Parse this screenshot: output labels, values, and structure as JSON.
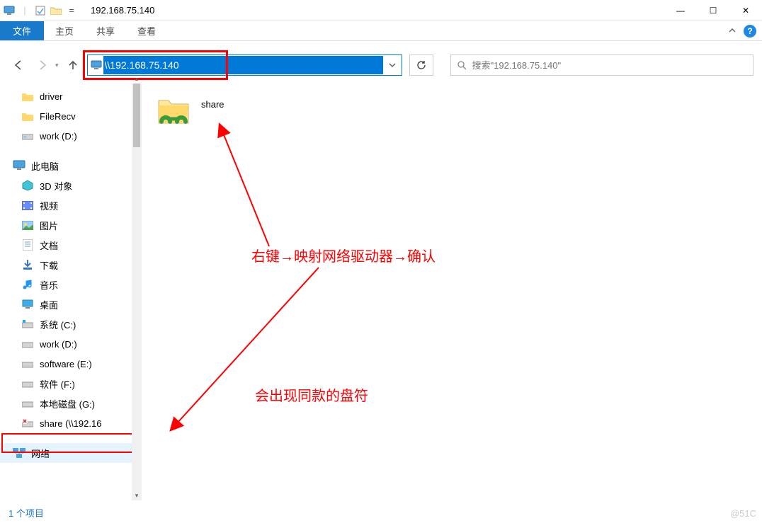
{
  "titlebar": {
    "title": "192.168.75.140",
    "minimize": "—",
    "maximize": "☐",
    "close": "✕"
  },
  "ribbon": {
    "file": "文件",
    "tabs": [
      "主页",
      "共享",
      "查看"
    ],
    "help": "?"
  },
  "nav": {
    "address": "\\\\192.168.75.140",
    "refresh": "↻",
    "search_placeholder": "搜索\"192.168.75.140\""
  },
  "tree": {
    "quick": [
      {
        "label": "driver",
        "icon": "folder"
      },
      {
        "label": "FileRecv",
        "icon": "folder"
      },
      {
        "label": "work (D:)",
        "icon": "drive"
      }
    ],
    "thispc_label": "此电脑",
    "thispc": [
      {
        "label": "3D 对象",
        "icon": "3d"
      },
      {
        "label": "视频",
        "icon": "video"
      },
      {
        "label": "图片",
        "icon": "pictures"
      },
      {
        "label": "文档",
        "icon": "documents"
      },
      {
        "label": "下载",
        "icon": "downloads"
      },
      {
        "label": "音乐",
        "icon": "music"
      },
      {
        "label": "桌面",
        "icon": "desktop"
      },
      {
        "label": "系统 (C:)",
        "icon": "osdrive"
      },
      {
        "label": "work (D:)",
        "icon": "drive"
      },
      {
        "label": "software (E:)",
        "icon": "drive"
      },
      {
        "label": "软件 (F:)",
        "icon": "drive"
      },
      {
        "label": "本地磁盘 (G:)",
        "icon": "drive"
      },
      {
        "label": "share (\\\\192.16",
        "icon": "netdrive-x"
      }
    ],
    "network_label": "网络"
  },
  "content": {
    "item_label": "share"
  },
  "annotations": {
    "line1": "右键→映射网络驱动器→确认",
    "line2": "会出现同款的盘符"
  },
  "statusbar": {
    "text": "1 个项目"
  },
  "watermark": "@51C"
}
